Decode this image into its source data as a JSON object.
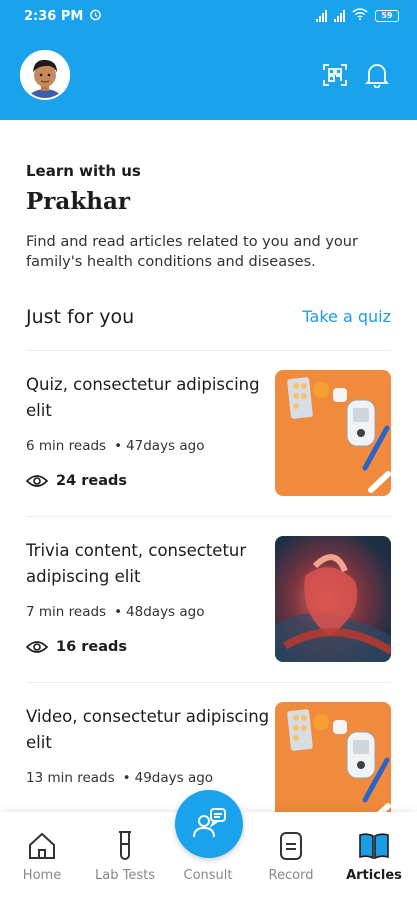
{
  "status_bar": {
    "time": "2:36 PM",
    "battery": "59"
  },
  "header": {
    "avatar_icon": "user-avatar",
    "scan_icon": "qr-scan-icon",
    "notification_icon": "bell-icon"
  },
  "intro": {
    "eyebrow": "Learn with us",
    "name": "Prakhar",
    "description": "Find and read articles related to you and your family's health conditions and diseases."
  },
  "section": {
    "title": "Just for you",
    "action": "Take a quiz"
  },
  "articles": [
    {
      "title": "Quiz, consectetur adipiscing elit",
      "read_time": "6 min reads",
      "age": "47days ago",
      "reads": "24 reads",
      "image": "diabetes-kit-photo"
    },
    {
      "title": "Trivia content, consectetur adipiscing elit",
      "read_time": "7 min reads",
      "age": "48days ago",
      "reads": "16 reads",
      "image": "heart-illustration"
    },
    {
      "title": "Video, consectetur adipiscing elit",
      "read_time": "13 min reads",
      "age": "49days ago",
      "reads": "",
      "image": "diabetes-kit-photo"
    }
  ],
  "nav": {
    "home": "Home",
    "lab_tests": "Lab Tests",
    "consult": "Consult",
    "record": "Record",
    "articles": "Articles",
    "active": "articles"
  },
  "colors": {
    "brand": "#1aa3ec",
    "link": "#1a9ce6"
  }
}
